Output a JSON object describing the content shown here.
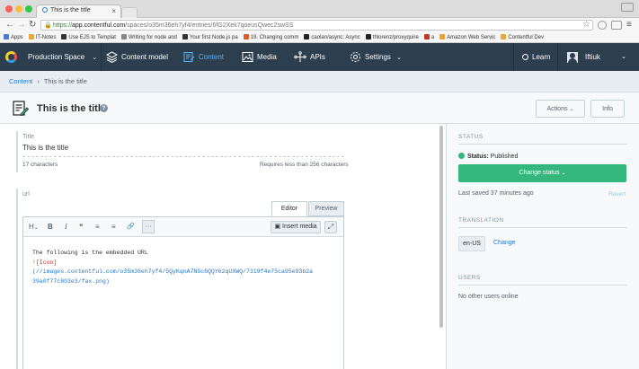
{
  "browser": {
    "tab_title": "This is the title",
    "url_https": "https://",
    "url_host": "app.contentful.com",
    "url_path": "/spaces/o35m36eh7yf4/entries/6fG2Xek7qoeusQwec2swSS",
    "bookmarks": [
      {
        "label": "Apps",
        "color": "#4a7bd0"
      },
      {
        "label": "IT-Notes",
        "color": "#e8a838"
      },
      {
        "label": "Use EJS to Templat",
        "color": "#333333"
      },
      {
        "label": "Writing for node and",
        "color": "#888888"
      },
      {
        "label": "Your first Node.js pa",
        "color": "#333333"
      },
      {
        "label": "19. Changing comm",
        "color": "#e05a2a"
      },
      {
        "label": "caolan/async: Async",
        "color": "#222222"
      },
      {
        "label": "thlorenz/proxyquire",
        "color": "#222222"
      },
      {
        "label": "a",
        "color": "#c0392b"
      },
      {
        "label": "Amazon Web Servic",
        "color": "#f0a030"
      },
      {
        "label": "Contentful Dev",
        "color": "#e8a838"
      }
    ]
  },
  "header": {
    "space": "Production Space",
    "nav": [
      "Content model",
      "Content",
      "Media",
      "APIs",
      "Settings"
    ],
    "learn": "Learn",
    "user": "Iftiuk"
  },
  "breadcrumb": {
    "root": "Content",
    "separator": "›",
    "current": "This is the title"
  },
  "entry": {
    "title": "This is the title",
    "actions_label": "Actions",
    "info_label": "Info"
  },
  "fields": {
    "title": {
      "label": "Title",
      "value": "This is the title",
      "count": "17 characters",
      "limit": "Requires less than 256 characters"
    },
    "url": {
      "label": "url",
      "tab_editor": "Editor",
      "tab_preview": "Preview",
      "toolbar": [
        "H",
        "B",
        "I",
        "❝",
        "≡",
        "≡",
        "🔗",
        "···"
      ],
      "insert_media": "Insert media",
      "line1": "The following is the embedded URL",
      "line2": "![Icon]",
      "line3": "(//images.contentful.com/o35m36eh7yf4/5QyKqnA7NSc6QQY62qUXWQ/7319f4e75ca95e93b2a",
      "line4": "39a0f77c803e3/fax.png)"
    }
  },
  "sidebar": {
    "status_heading": "STATUS",
    "status_label": "Status:",
    "status_value": "Published",
    "status_color": "#34b77d",
    "change_status": "Change status",
    "last_saved": "Last saved 37 minutes ago",
    "revert": "Revert",
    "translation_heading": "TRANSLATION",
    "locale": "en-US",
    "change": "Change",
    "users_heading": "USERS",
    "users_text": "No other users online"
  }
}
